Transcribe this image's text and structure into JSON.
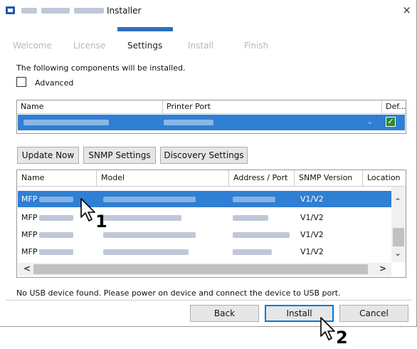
{
  "window": {
    "title": "Installer",
    "close_glyph": "×"
  },
  "steps": [
    "Welcome",
    "License",
    "Settings",
    "Install",
    "Finish"
  ],
  "active_step": "Settings",
  "intro_text": "The following components will be installed.",
  "advanced_label": "Advanced",
  "components_table": {
    "headers": [
      "Name",
      "Printer Port",
      "Def..."
    ]
  },
  "buttons": {
    "update_now": "Update Now",
    "snmp_settings": "SNMP Settings",
    "discovery_settings": "Discovery Settings",
    "back": "Back",
    "install": "Install",
    "cancel": "Cancel"
  },
  "devices_table": {
    "headers": [
      "Name",
      "Model",
      "Address / Port",
      "SNMP Version",
      "Location"
    ],
    "rows": [
      {
        "name": "MFP",
        "snmp": "V1/V2"
      },
      {
        "name": "MFP",
        "snmp": "V1/V2"
      },
      {
        "name": "MFP",
        "snmp": "V1/V2"
      },
      {
        "name": "MFP",
        "snmp": "V1/V2"
      }
    ]
  },
  "footer_message": "No USB device found. Please power on device and connect the device to USB port.",
  "callouts": [
    "1",
    "2"
  ]
}
